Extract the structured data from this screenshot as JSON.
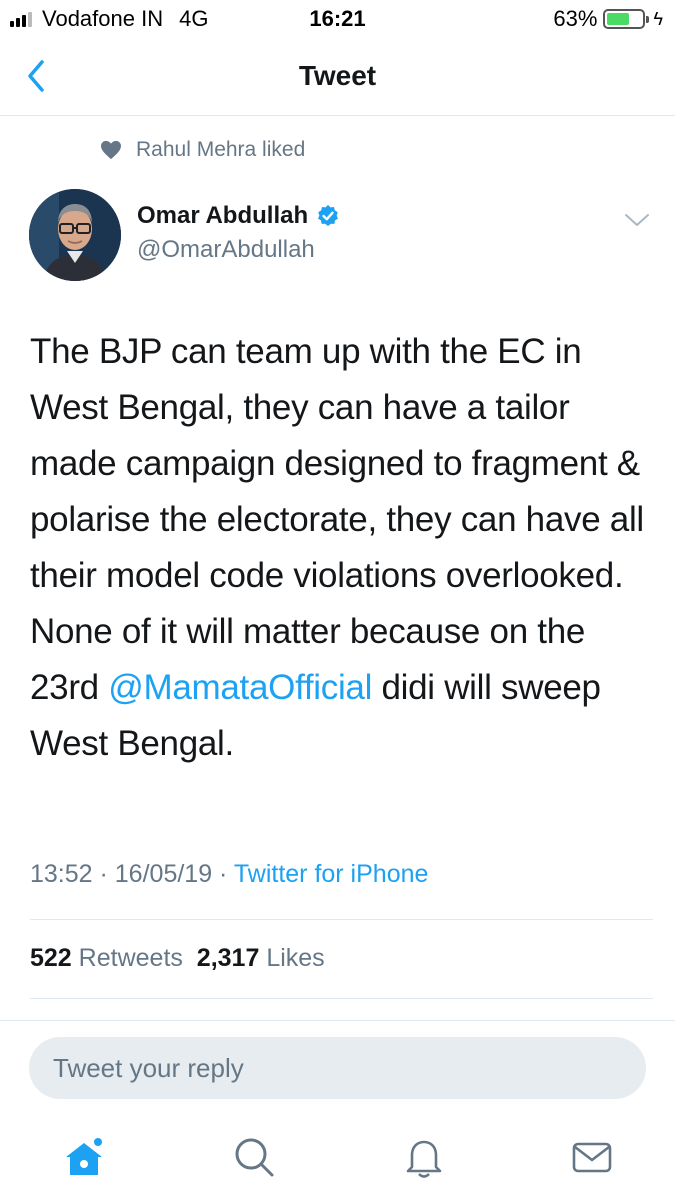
{
  "status_bar": {
    "carrier": "Vodafone IN",
    "network": "4G",
    "time": "16:21",
    "battery_percent": "63%",
    "battery_level": 0.63,
    "battery_color": "#4cd964"
  },
  "nav": {
    "title": "Tweet",
    "back_icon": "chevron-left-icon"
  },
  "social_context": {
    "icon": "heart-icon",
    "text": "Rahul Mehra liked"
  },
  "author": {
    "name": "Omar Abdullah",
    "handle": "@OmarAbdullah",
    "verified": true,
    "avatar_icon": "avatar"
  },
  "tweet": {
    "text_before_mention": "The BJP can team up with the EC in West Bengal, they can have a tailor made campaign designed to fragment & polarise the electorate, they can have all their model code violations overlooked. None of it will matter because on the 23rd ",
    "mention": "@MamataOfficial",
    "text_after_mention": " didi will sweep West Bengal."
  },
  "meta": {
    "time": "13:52",
    "separator": " · ",
    "date": "16/05/19",
    "source": "Twitter for iPhone"
  },
  "counts": {
    "retweets_value": "522",
    "retweets_label": "Retweets",
    "likes_value": "2,317",
    "likes_label": "Likes"
  },
  "reply": {
    "placeholder": "Tweet your reply"
  },
  "tabs": [
    {
      "name": "home",
      "icon": "home-icon"
    },
    {
      "name": "search",
      "icon": "search-icon"
    },
    {
      "name": "notifications",
      "icon": "bell-icon"
    },
    {
      "name": "messages",
      "icon": "mail-icon"
    }
  ],
  "colors": {
    "accent": "#1da1f2",
    "secondary_text": "#657786",
    "primary_text": "#14171a"
  }
}
